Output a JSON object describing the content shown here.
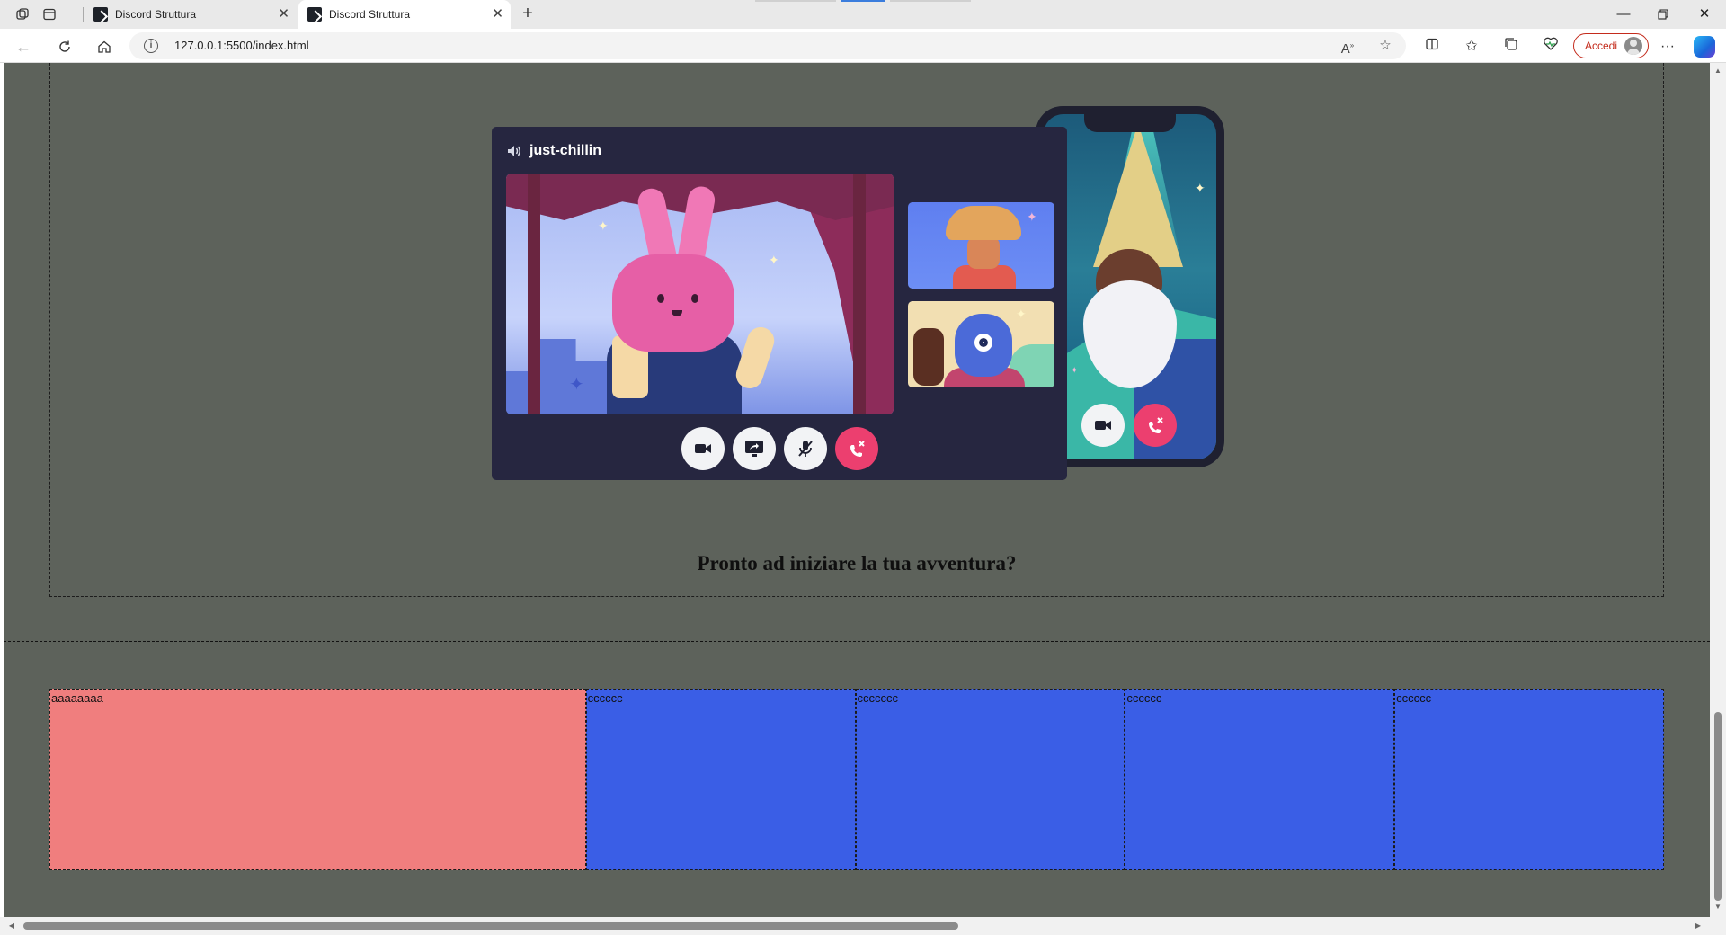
{
  "browser": {
    "tabs": [
      {
        "title": "Discord Struttura",
        "active": false
      },
      {
        "title": "Discord Struttura",
        "active": true
      }
    ],
    "url": "127.0.0.1:5500/index.html",
    "signin_label": "Accedi"
  },
  "icons": {
    "workspaces": "workspaces-icon",
    "tab_actions": "tab-actions-icon",
    "back": "back-arrow-icon",
    "refresh": "refresh-icon",
    "home": "home-icon",
    "read_aloud": "read-aloud-icon",
    "favorite": "star-icon",
    "split": "split-screen-icon",
    "favorites": "favorites-icon",
    "collections": "collections-icon",
    "browser_essentials": "heart-pulse-icon",
    "more": "more-icon",
    "copilot": "copilot-icon"
  },
  "illustration": {
    "channel_name": "just-chillin"
  },
  "hero": {
    "title": "Pronto ad iniziare la tua avventura?"
  },
  "cells": [
    {
      "text": "aaaaaaaa",
      "color": "#f07e7e"
    },
    {
      "text": "cccccc",
      "color": "#3a5ee6"
    },
    {
      "text": "ccccccc",
      "color": "#3a5ee6"
    },
    {
      "text": "cccccc",
      "color": "#3a5ee6"
    },
    {
      "text": "cccccc",
      "color": "#3a5ee6"
    }
  ],
  "colors": {
    "page_background": "#5d625b",
    "call_window": "#262640",
    "hangup": "#ec3f6f",
    "signin_accent": "#c42b1c"
  }
}
